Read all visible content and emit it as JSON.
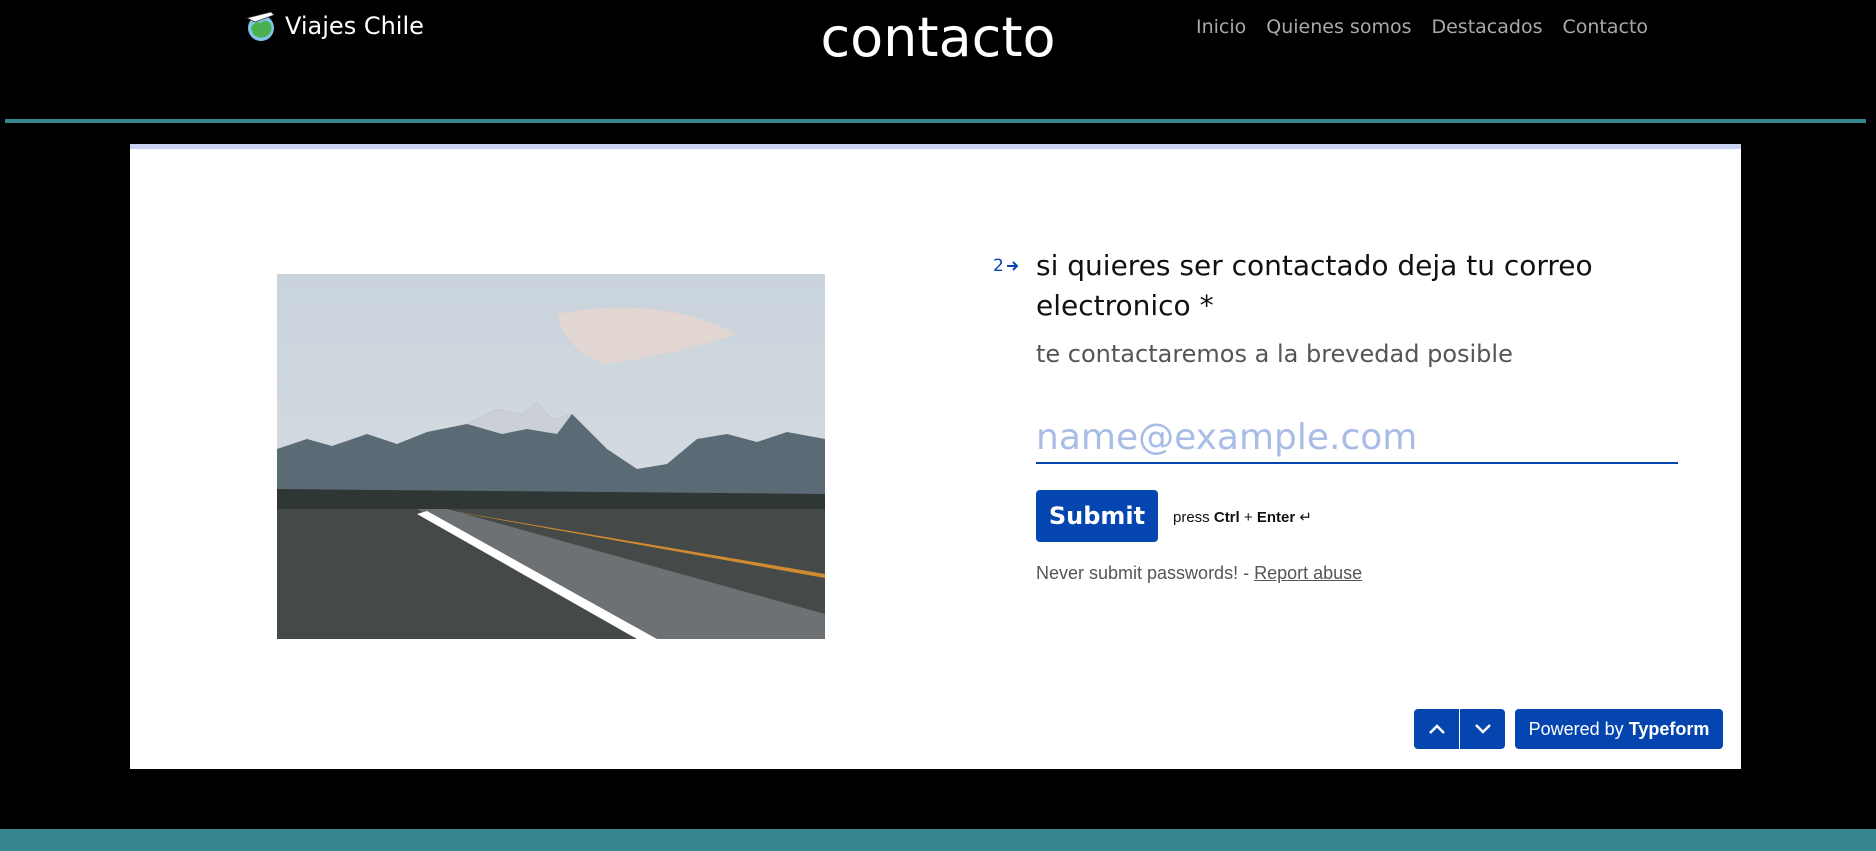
{
  "header": {
    "brand": "Viajes Chile",
    "page_title": "contacto",
    "nav": [
      "Inicio",
      "Quienes somos",
      "Destacados",
      "Contacto"
    ]
  },
  "form": {
    "question_number": "2",
    "question": "si quieres ser contactado deja tu correo electronico *",
    "description": "te contactaremos a la brevedad posible",
    "email_placeholder": "name@example.com",
    "submit_label": "Submit",
    "hint": {
      "press": "press",
      "key1": "Ctrl",
      "plus": "+",
      "key2": "Enter",
      "enter_glyph": "↵"
    },
    "note": "Never submit passwords! -",
    "report_abuse": "Report abuse",
    "powered_prefix": "Powered by",
    "powered_brand": "Typeform"
  },
  "colors": {
    "background": "#000000",
    "accent_teal": "#36868f",
    "typeform_blue": "#0445af"
  },
  "icons": [
    "airplane-globe-logo-icon",
    "arrow-right-icon",
    "chevron-up-icon",
    "chevron-down-icon"
  ]
}
